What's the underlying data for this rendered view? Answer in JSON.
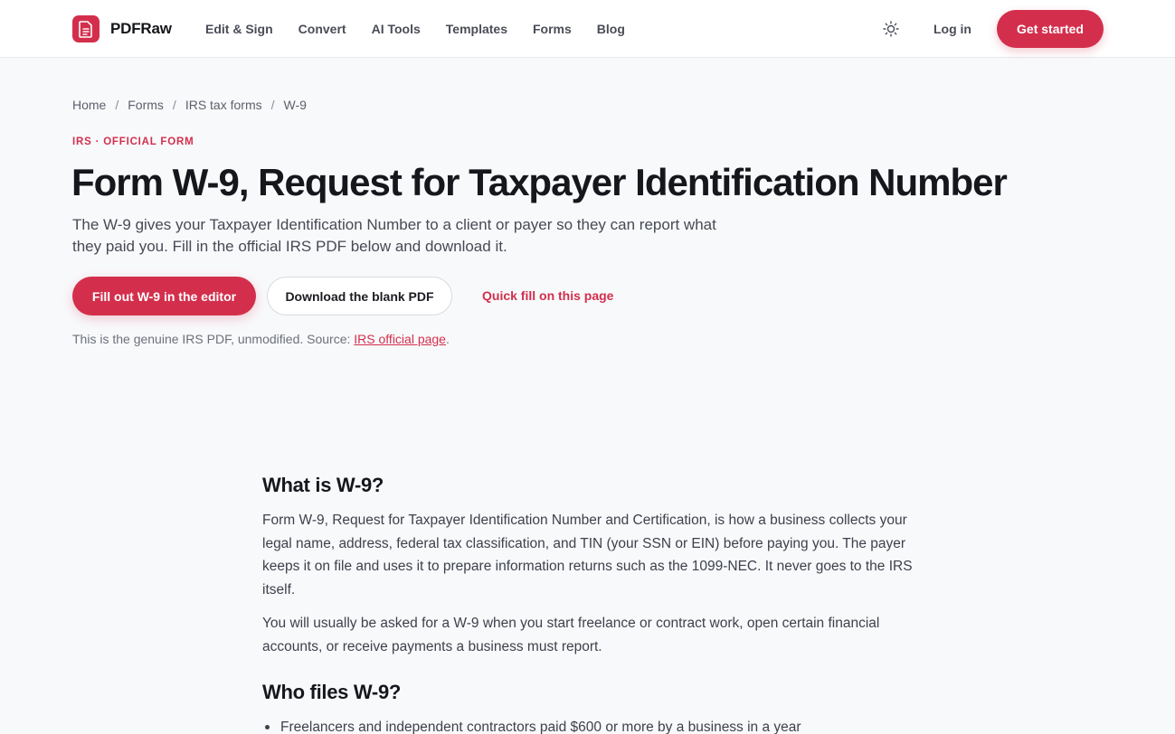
{
  "header": {
    "brand": "PDFRaw",
    "nav": [
      "Edit & Sign",
      "Convert",
      "AI Tools",
      "Templates",
      "Forms",
      "Blog"
    ],
    "login": "Log in",
    "cta": "Get started",
    "theme_icon": "sun-icon"
  },
  "breadcrumb": [
    "Home",
    "Forms",
    "IRS tax forms",
    "W-9"
  ],
  "hero": {
    "eyebrow": "IRS · OFFICIAL FORM",
    "title": "Form W-9, Request for Taxpayer Identification Number",
    "subtitle": "The W-9 gives your Taxpayer Identification Number to a client or payer so they can report what they paid you. Fill in the official IRS PDF below and download it.",
    "primary_button": "Fill out W-9 in the editor",
    "secondary_button": "Download the blank PDF",
    "link_button": "Quick fill on this page",
    "source_prefix": "This is the genuine IRS PDF, unmodified. Source: ",
    "source_link": "IRS official page",
    "source_suffix": "."
  },
  "article": {
    "what_heading": "What is W-9?",
    "what_p1": "Form W-9, Request for Taxpayer Identification Number and Certification, is how a business collects your legal name, address, federal tax classification, and TIN (your SSN or EIN) before paying you. The payer keeps it on file and uses it to prepare information returns such as the 1099-NEC. It never goes to the IRS itself.",
    "what_p2": "You will usually be asked for a W-9 when you start freelance or contract work, open certain financial accounts, or receive payments a business must report.",
    "who_heading": "Who files W-9?",
    "who_items": [
      "Freelancers and independent contractors paid $600 or more by a business in a year"
    ]
  },
  "colors": {
    "accent": "#d32f4c",
    "background": "#f8f9fb",
    "text": "#16171c"
  }
}
